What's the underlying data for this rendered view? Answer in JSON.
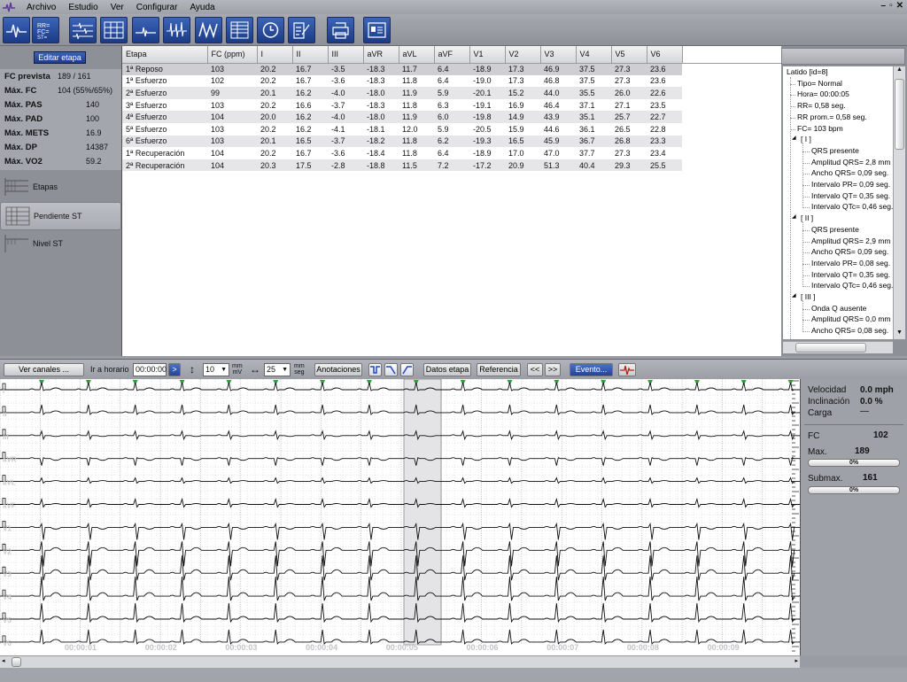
{
  "menu": [
    "Archivo",
    "Estudio",
    "Ver",
    "Configurar",
    "Ayuda"
  ],
  "toolbar": {
    "icons": [
      "ecg-wave",
      "rr-fc-st",
      "ecg-multi",
      "grid-ecg",
      "wave-small",
      "beats",
      "average-beat",
      "table",
      "clock",
      "edit-doc",
      "printer",
      "report"
    ]
  },
  "left": {
    "edit_stage": "Editar etapa",
    "stats": [
      {
        "label": "FC prevista",
        "value": "189 / 161"
      },
      {
        "label": "Máx. FC",
        "value": "104  (55%/65%)"
      },
      {
        "label": "Máx. PAS",
        "value": "140"
      },
      {
        "label": "Máx. PAD",
        "value": "100"
      },
      {
        "label": "Máx. METS",
        "value": "16.9"
      },
      {
        "label": "Máx. DP",
        "value": "14387"
      },
      {
        "label": "Máx. VO2",
        "value": "59.2"
      }
    ],
    "nav": [
      "Etapas",
      "Pendiente ST",
      "Nivel ST"
    ]
  },
  "table": {
    "headers": [
      "Etapa",
      "FC (ppm)",
      "I",
      "II",
      "III",
      "aVR",
      "aVL",
      "aVF",
      "V1",
      "V2",
      "V3",
      "V4",
      "V5",
      "V6"
    ],
    "rows": [
      [
        "1ª Reposo",
        "103",
        "20.2",
        "16.7",
        "-3.5",
        "-18.3",
        "11.7",
        "6.4",
        "-18.9",
        "17.3",
        "46.9",
        "37.5",
        "27.3",
        "23.6"
      ],
      [
        "1ª Esfuerzo",
        "102",
        "20.2",
        "16.7",
        "-3.6",
        "-18.3",
        "11.8",
        "6.4",
        "-19.0",
        "17.3",
        "46.8",
        "37.5",
        "27.3",
        "23.6"
      ],
      [
        "2ª Esfuerzo",
        "99",
        "20.1",
        "16.2",
        "-4.0",
        "-18.0",
        "11.9",
        "5.9",
        "-20.1",
        "15.2",
        "44.0",
        "35.5",
        "26.0",
        "22.6"
      ],
      [
        "3ª Esfuerzo",
        "103",
        "20.2",
        "16.6",
        "-3.7",
        "-18.3",
        "11.8",
        "6.3",
        "-19.1",
        "16.9",
        "46.4",
        "37.1",
        "27.1",
        "23.5"
      ],
      [
        "4ª Esfuerzo",
        "104",
        "20.0",
        "16.2",
        "-4.0",
        "-18.0",
        "11.9",
        "6.0",
        "-19.8",
        "14.9",
        "43.9",
        "35.1",
        "25.7",
        "22.7"
      ],
      [
        "5ª Esfuerzo",
        "103",
        "20.2",
        "16.2",
        "-4.1",
        "-18.1",
        "12.0",
        "5.9",
        "-20.5",
        "15.9",
        "44.6",
        "36.1",
        "26.5",
        "22.8"
      ],
      [
        "6ª Esfuerzo",
        "103",
        "20.1",
        "16.5",
        "-3.7",
        "-18.2",
        "11.8",
        "6.2",
        "-19.3",
        "16.5",
        "45.9",
        "36.7",
        "26.8",
        "23.3"
      ],
      [
        "1ª Recuperación",
        "104",
        "20.2",
        "16.7",
        "-3.6",
        "-18.4",
        "11.8",
        "6.4",
        "-18.9",
        "17.0",
        "47.0",
        "37.7",
        "27.3",
        "23.4"
      ],
      [
        "2ª Recuperación",
        "104",
        "20.3",
        "17.5",
        "-2.8",
        "-18.8",
        "11.5",
        "7.2",
        "-17.2",
        "20.9",
        "51.3",
        "40.4",
        "29.3",
        "25.5"
      ]
    ]
  },
  "tree": {
    "root": "Latido  [id=8]",
    "info": [
      "Tipo= Normal",
      "Hora= 00:00:05",
      "RR= 0,58 seg.",
      "RR prom.= 0,58 seg.",
      "FC= 103 bpm"
    ],
    "leads": [
      {
        "name": "[ I ]",
        "items": [
          "QRS presente",
          "Amplitud QRS= 2,8 mm",
          "Ancho QRS= 0,09 seg.",
          "Intervalo PR= 0,09 seg.",
          "Intervalo QT= 0,35 seg.",
          "Intervalo QTc= 0,46 seg."
        ]
      },
      {
        "name": "[ II ]",
        "items": [
          "QRS presente",
          "Amplitud QRS= 2,9 mm",
          "Ancho QRS= 0,09 seg.",
          "Intervalo PR= 0,08 seg.",
          "Intervalo QT= 0,35 seg.",
          "Intervalo QTc= 0,46 seg."
        ]
      },
      {
        "name": "[ III ]",
        "items": [
          "Onda Q ausente",
          "Amplitud QRS= 0,0 mm",
          "Ancho QRS= 0,08 seg."
        ]
      }
    ]
  },
  "ecg_toolbar": {
    "ver_canales": "Ver canales ...",
    "ir_a_horario": "Ir a horario",
    "time": "00:00:00",
    "go": ">",
    "gain": "10",
    "gain_unit_top": "mm",
    "gain_unit_bottom": "mV",
    "speed": "25",
    "speed_unit_top": "mm",
    "speed_unit_bottom": "seg",
    "anotaciones": "Anotaciones",
    "datos_etapa": "Datos etapa",
    "referencia": "Referencia",
    "prev": "<<",
    "next": ">>",
    "evento": "Evento..."
  },
  "ecg": {
    "leads": [
      "I",
      "II",
      "III",
      "aVR",
      "aVL",
      "aVF",
      "V1",
      "V2",
      "V3",
      "V4",
      "V5",
      "V6"
    ],
    "time_labels": [
      "00:00:01",
      "00:00:02",
      "00:00:03",
      "00:00:04",
      "00:00:05",
      "00:00:06",
      "00:00:07",
      "00:00:08",
      "00:00:09"
    ],
    "beat_markers_count": 17
  },
  "side": {
    "velocidad_label": "Velocidad",
    "velocidad_value": "0.0 mph",
    "inclinacion_label": "Inclinación",
    "inclinacion_value": "0.0 %",
    "carga_label": "Carga",
    "carga_value": "—",
    "fc_label": "FC",
    "fc_value": "102",
    "max_label": "Max.",
    "max_value": "189",
    "max_pct": "0%",
    "submax_label": "Submax.",
    "submax_value": "161",
    "submax_pct": "0%"
  }
}
